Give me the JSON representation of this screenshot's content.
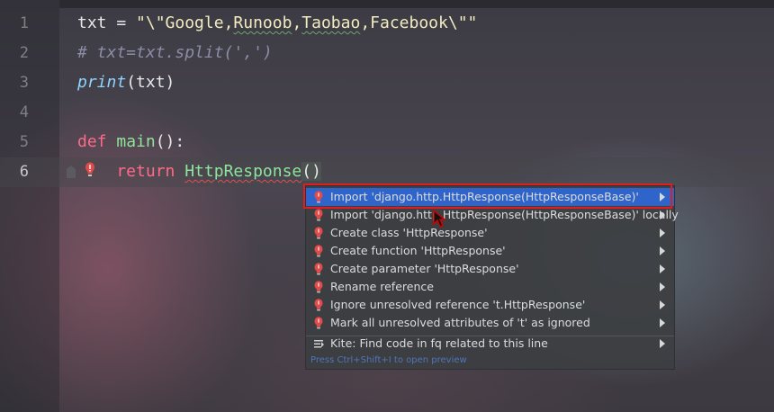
{
  "editor": {
    "lines": [
      {
        "num": "1"
      },
      {
        "num": "2"
      },
      {
        "num": "3"
      },
      {
        "num": "4"
      },
      {
        "num": "5"
      },
      {
        "num": "6"
      }
    ],
    "tokens": {
      "l1_a": "txt",
      "l1_b": " = ",
      "l1_c": "\"\\\"Google,",
      "l1_d": "Runoob",
      "l1_e": ",",
      "l1_f": "Taobao",
      "l1_g": ",",
      "l1_h": "Facebook",
      "l1_i": "\\\"\"",
      "l2_a": "# txt=txt.split(',')",
      "l3_a": "print",
      "l3_b": "(txt)",
      "l5_a": "def ",
      "l5_b": "main",
      "l5_c": "():",
      "l6_a": "    return ",
      "l6_b": "HttpResponse",
      "l6_c": "()"
    }
  },
  "popup": {
    "items": [
      {
        "label": "Import 'django.http.HttpResponse(HttpResponseBase)'",
        "icon": "bulb-red-icon"
      },
      {
        "label": "Import 'django.http.HttpResponse(HttpResponseBase)' locally",
        "icon": "bulb-red-icon"
      },
      {
        "label": "Create class 'HttpResponse'",
        "icon": "bulb-red-icon"
      },
      {
        "label": "Create function 'HttpResponse'",
        "icon": "bulb-red-icon"
      },
      {
        "label": "Create parameter 'HttpResponse'",
        "icon": "bulb-red-icon"
      },
      {
        "label": "Rename reference",
        "icon": "bulb-red-icon"
      },
      {
        "label": "Ignore unresolved reference 't.HttpResponse'",
        "icon": "bulb-red-icon"
      },
      {
        "label": "Mark all unresolved attributes of 't' as ignored",
        "icon": "bulb-red-icon"
      },
      {
        "label": "Kite: Find code in fq related to this line",
        "icon": "kite-icon"
      }
    ],
    "footer": "Press Ctrl+Shift+I to open preview"
  },
  "colors": {
    "selection": "#2f65ca",
    "highlight_box": "#e01e1e",
    "keyword": "#ff6a8a",
    "string": "#f3ecc0"
  }
}
